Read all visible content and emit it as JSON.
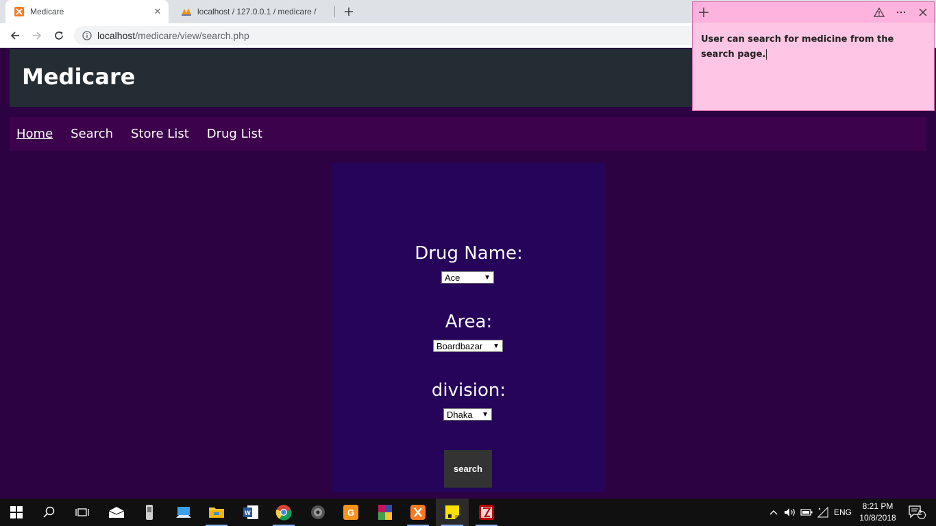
{
  "browser": {
    "tabs": [
      {
        "title": "Medicare",
        "icon": "xampp-icon",
        "active": true
      },
      {
        "title": "localhost / 127.0.0.1 / medicare /",
        "icon": "phpmyadmin-icon",
        "active": false
      }
    ],
    "url_host": "localhost",
    "url_path": "/medicare/view/search.php"
  },
  "site": {
    "title": "Medicare",
    "nav": [
      "Home",
      "Search",
      "Store List",
      "Drug List"
    ]
  },
  "search_form": {
    "drug_label": "Drug Name:",
    "drug_value": "Ace",
    "area_label": "Area:",
    "area_value": "Boardbazar",
    "division_label": "division:",
    "division_value": "Dhaka",
    "button_label": "search"
  },
  "sticky_note": {
    "text": "User can search for medicine from the search page."
  },
  "taskbar": {
    "language": "ENG",
    "time": "8:21 PM",
    "date": "10/8/2018",
    "notifications": "2"
  },
  "colors": {
    "page_bg": "#2d0243",
    "header_bg": "#232d33",
    "nav_bg": "#3c024b",
    "panel_bg": "#25045a",
    "button_bg": "#333333",
    "sticky_bg": "#fec6e4"
  }
}
